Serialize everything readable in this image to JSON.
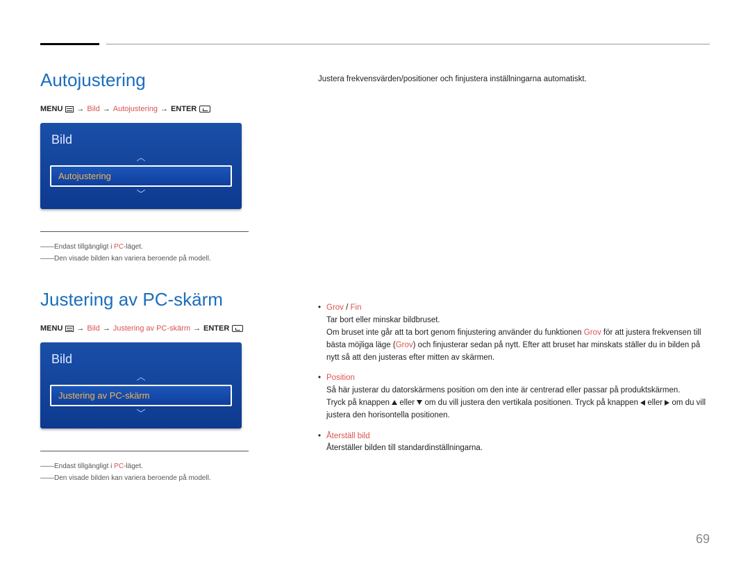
{
  "page_number": "69",
  "section1": {
    "heading": "Autojustering",
    "breadcrumb": {
      "menu": "MENU",
      "bild": "Bild",
      "item": "Autojustering",
      "enter": "ENTER"
    },
    "menu_box": {
      "title": "Bild",
      "selected": "Autojustering"
    },
    "notes": {
      "n1_pre": "――Endast tillgängligt i ",
      "n1_hl": "PC",
      "n1_post": "-läget.",
      "n2": "――Den visade bilden kan variera beroende på modell."
    },
    "body": "Justera frekvensvärden/positioner och finjustera inställningarna automatiskt."
  },
  "section2": {
    "heading": "Justering av PC-skärm",
    "breadcrumb": {
      "menu": "MENU",
      "bild": "Bild",
      "item": "Justering av PC-skärm",
      "enter": "ENTER"
    },
    "menu_box": {
      "title": "Bild",
      "selected": "Justering av PC-skärm"
    },
    "notes": {
      "n1_pre": "――Endast tillgängligt i ",
      "n1_hl": "PC",
      "n1_post": "-läget.",
      "n2": "――Den visade bilden kan variera beroende på modell."
    },
    "bullets": {
      "b1": {
        "label_a": "Grov",
        "slash": " / ",
        "label_b": "Fin",
        "p1": "Tar bort eller minskar bildbruset.",
        "p2a": "Om bruset inte går att ta bort genom finjustering använder du funktionen ",
        "p2hl1": "Grov",
        "p2b": " för att justera frekvensen till bästa möjliga läge (",
        "p2hl2": "Grov",
        "p2c": ") och finjusterar sedan på nytt. Efter att bruset har minskats ställer du in bilden på nytt så att den justeras efter mitten av skärmen."
      },
      "b2": {
        "label": "Position",
        "p1": "Så här justerar du datorskärmens position om den inte är centrerad eller passar på produktskärmen.",
        "p2a": "Tryck på knappen ",
        "p2b": " eller ",
        "p2c": " om du vill justera den vertikala positionen. Tryck på knappen ",
        "p2d": " eller ",
        "p2e": " om du vill justera den horisontella positionen."
      },
      "b3": {
        "label": "Återställ bild",
        "p1": "Återställer bilden till standardinställningarna."
      }
    }
  }
}
